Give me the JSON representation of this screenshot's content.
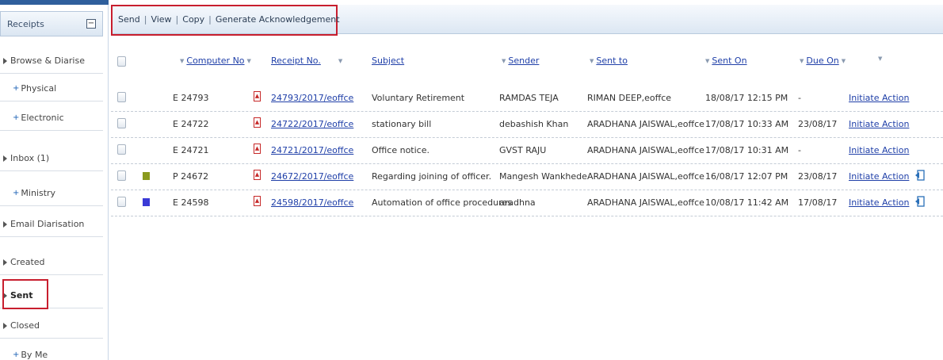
{
  "sidebar": {
    "header": "Receipts",
    "collapse_symbol": "−",
    "items": [
      {
        "label": "Browse & Diarise",
        "type": "parent"
      },
      {
        "label": "Physical",
        "type": "child"
      },
      {
        "label": "Electronic",
        "type": "child"
      },
      {
        "label": "Inbox (1)",
        "type": "parent"
      },
      {
        "label": "Ministry",
        "type": "child"
      },
      {
        "label": "Email Diarisation",
        "type": "parent"
      },
      {
        "label": "Created",
        "type": "parent"
      },
      {
        "label": "Sent",
        "type": "parent",
        "selected": true
      },
      {
        "label": "Closed",
        "type": "parent"
      },
      {
        "label": "By Me",
        "type": "child"
      }
    ]
  },
  "toolbar": {
    "send": "Send",
    "view": "View",
    "copy": "Copy",
    "generate": "Generate Acknowledgement",
    "separator": "|"
  },
  "table": {
    "headers": {
      "computer_no": "Computer No",
      "receipt_no": "Receipt No.",
      "subject": "Subject",
      "sender": "Sender",
      "sent_to": "Sent to",
      "sent_on": "Sent On",
      "due_on": "Due On"
    },
    "rows": [
      {
        "priority": "",
        "computer_no": "E  24793",
        "receipt_no": "24793/2017/eoffce",
        "subject": "Voluntary Retirement",
        "sender": "RAMDAS TEJA",
        "sent_to": "RIMAN DEEP,eoffce",
        "sent_on": "18/08/17 12:15 PM",
        "due_on": "-",
        "action": "Initiate Action",
        "reply": false
      },
      {
        "priority": "",
        "computer_no": "E  24722",
        "receipt_no": "24722/2017/eoffce",
        "subject": "stationary bill",
        "sender": "debashish Khan",
        "sent_to": "ARADHANA JAISWAL,eoffce",
        "sent_on": "17/08/17 10:33 AM",
        "due_on": "23/08/17",
        "action": "Initiate Action",
        "reply": false
      },
      {
        "priority": "",
        "computer_no": "E  24721",
        "receipt_no": "24721/2017/eoffce",
        "subject": "Office notice.",
        "sender": "GVST RAJU",
        "sent_to": "ARADHANA JAISWAL,eoffce",
        "sent_on": "17/08/17 10:31 AM",
        "due_on": "-",
        "action": "Initiate Action",
        "reply": false
      },
      {
        "priority": "#8a9a1e",
        "computer_no": "P  24672",
        "receipt_no": "24672/2017/eoffce",
        "subject": "Regarding joining of officer.",
        "sender": "Mangesh Wankhede",
        "sent_to": "ARADHANA JAISWAL,eoffce",
        "sent_on": "16/08/17 12:07 PM",
        "due_on": "23/08/17",
        "action": "Initiate Action",
        "reply": true
      },
      {
        "priority": "#3a3ad6",
        "computer_no": "E  24598",
        "receipt_no": "24598/2017/eoffce",
        "subject": "Automation of office procedures",
        "sender": "aradhna",
        "sent_to": "ARADHANA JAISWAL,eoffce",
        "sent_on": "10/08/17 11:42 AM",
        "due_on": "17/08/17",
        "action": "Initiate Action",
        "reply": true
      }
    ]
  },
  "colors": {
    "highlight_red": "#c81e2e",
    "link_blue": "#1f3fa8",
    "toolbar_top": "#f6f9fd",
    "toolbar_bottom": "#dce7f3"
  },
  "icons": {
    "pdf": "pdf-icon",
    "reply": "reply-icon",
    "sort": "sort-triangle-icon"
  }
}
